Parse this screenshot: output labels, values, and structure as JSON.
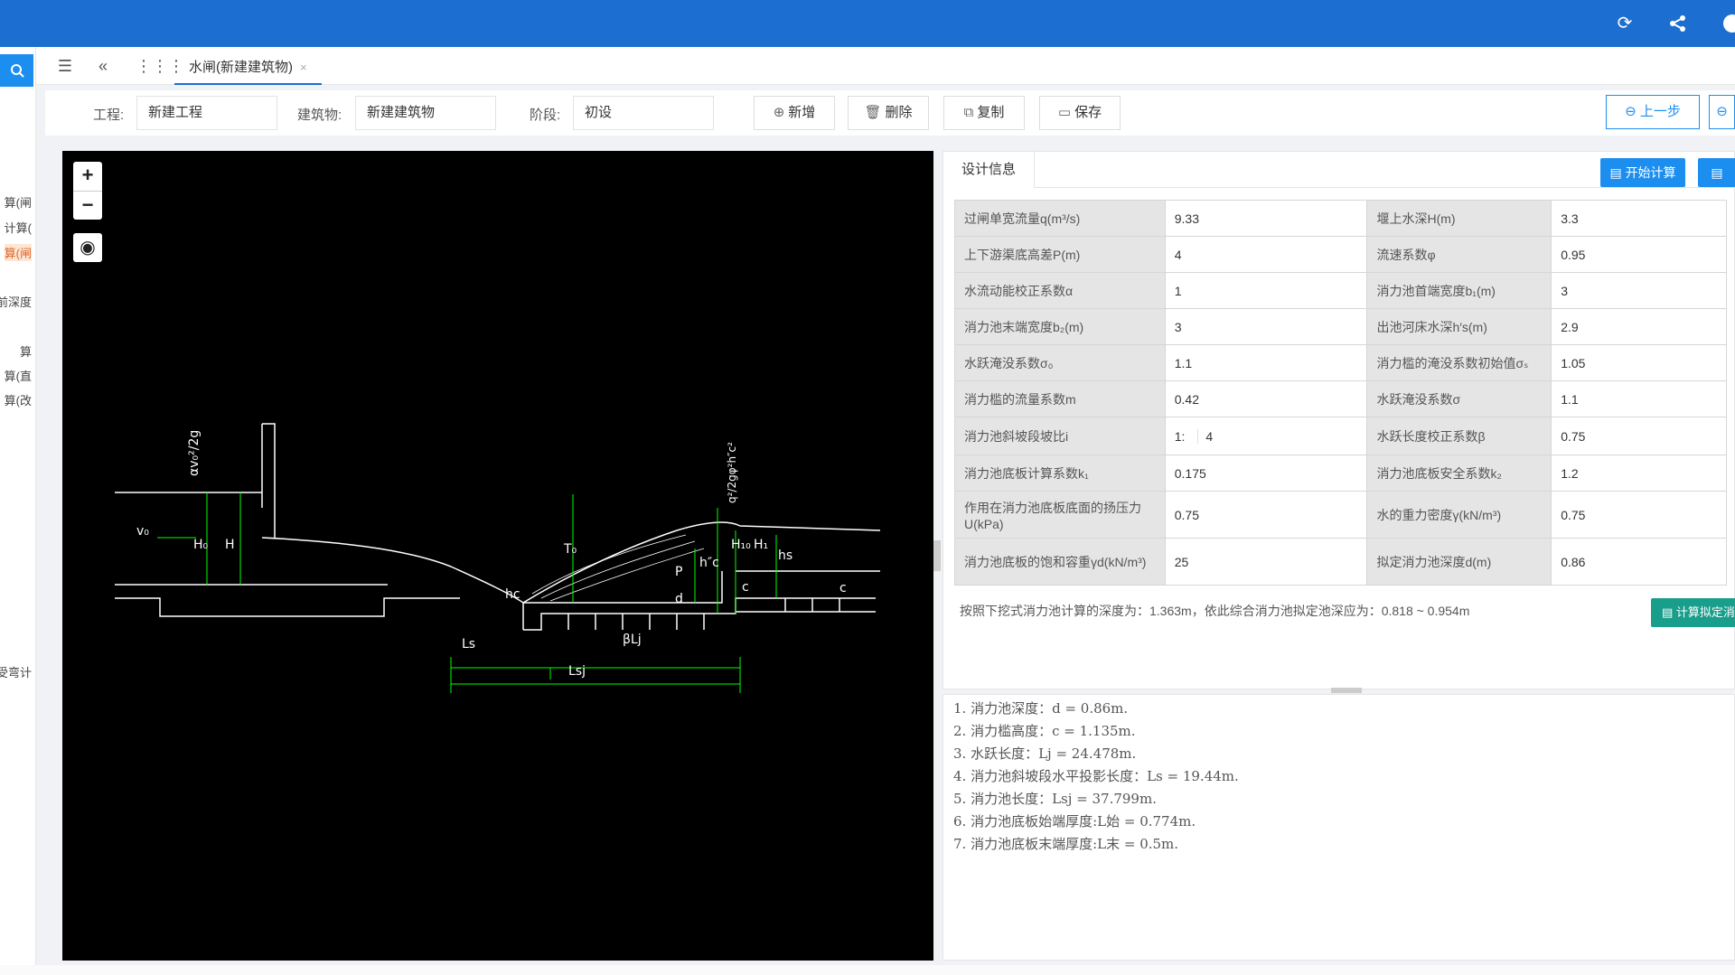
{
  "topbar": {
    "icons": [
      "refresh-icon",
      "share-icon",
      "help-icon"
    ]
  },
  "sidebar": {
    "items": [
      "算(闸",
      "计算(",
      "算(闸",
      "前深度",
      "算",
      "算(直",
      "算(改",
      "受弯计"
    ]
  },
  "tabbar": {
    "tab_label": "水闸(新建建筑物)",
    "close": "×"
  },
  "toolbar": {
    "project_label": "工程:",
    "project_value": "新建工程",
    "building_label": "建筑物:",
    "building_value": "新建建筑物",
    "stage_label": "阶段:",
    "stage_value": "初设",
    "add_label": "新增",
    "delete_label": "删除",
    "copy_label": "复制",
    "save_label": "保存",
    "prev_label": "上一步"
  },
  "canvas": {
    "zoom_in": "+",
    "zoom_out": "−"
  },
  "design": {
    "tab_label": "设计信息",
    "start_calc_label": "开始计算",
    "hint": "按照下挖式消力池计算的深度为：1.363m，依此综合消力池拟定池深应为：0.818 ~ 0.954m",
    "calc_depth_label": "计算拟定消",
    "rows": [
      {
        "k1": "过闸单宽流量q(m³/s)",
        "v1": "9.33",
        "k2": "堰上水深H(m)",
        "v2": "3.3"
      },
      {
        "k1": "上下游渠底高差P(m)",
        "v1": "4",
        "k2": "流速系数φ",
        "v2": "0.95"
      },
      {
        "k1": "水流动能校正系数α",
        "v1": "1",
        "k2": "消力池首端宽度b₁(m)",
        "v2": "3"
      },
      {
        "k1": "消力池末端宽度b₂(m)",
        "v1": "3",
        "k2": "出池河床水深h′s(m)",
        "v2": "2.9"
      },
      {
        "k1": "水跃淹没系数σ₀",
        "v1": "1.1",
        "k2": "消力槛的淹没系数初始值σₛ",
        "v2": "1.05"
      },
      {
        "k1": "消力槛的流量系数m",
        "v1": "0.42",
        "k2": "水跃淹没系数σ",
        "v2": "1.1"
      },
      {
        "k1": "消力池斜坡段坡比i",
        "v1": "1:",
        "v1b": "4",
        "k2": "水跃长度校正系数β",
        "v2": "0.75"
      },
      {
        "k1": "消力池底板计算系数k₁",
        "v1": "0.175",
        "k2": "消力池底板安全系数k₂",
        "v2": "1.2"
      },
      {
        "k1": "作用在消力池底板底面的扬压力U(kPa)",
        "v1": "0.75",
        "k2": "水的重力密度γ(kN/m³)",
        "v2": "0.75"
      },
      {
        "k1": "消力池底板的饱和容重γd(kN/m³)",
        "v1": "25",
        "k2": "拟定消力池深度d(m)",
        "v2": "0.86"
      }
    ]
  },
  "results": [
    "1. 消力池深度：d = 0.86m.",
    "2. 消力槛高度：c = 1.135m.",
    "3. 水跃长度：Lj = 24.478m.",
    "4. 消力池斜坡段水平投影长度：Ls = 19.44m.",
    "5. 消力池长度：Lsj = 37.799m.",
    "6. 消力池底板始端厚度:L始 = 0.774m.",
    "7. 消力池底板末端厚度:L末 = 0.5m."
  ],
  "drawing": {
    "labels": [
      "αv₀²/2g",
      "v₀",
      "H₀",
      "H",
      "T₀",
      "hc",
      "P",
      "h″c",
      "d",
      "c",
      "H₁₀",
      "H₁",
      "hs",
      "q²/2gφ²h″c²",
      "Ls",
      "βLj",
      "Lsj",
      "c"
    ]
  }
}
